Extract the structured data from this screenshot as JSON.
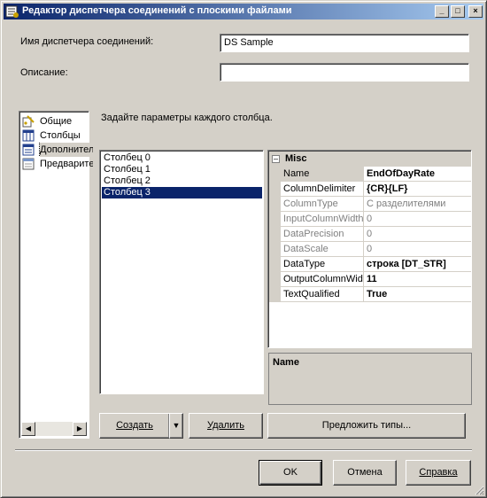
{
  "window": {
    "title": "Редактор диспетчера соединений с плоскими файлами",
    "icon": "flat-file-connection-icon"
  },
  "titlebar_buttons": {
    "minimize": "_",
    "maximize": "□",
    "close": "×"
  },
  "form": {
    "connection_name_label": "Имя диспетчера соединений:",
    "connection_name_value": "DS Sample",
    "description_label": "Описание:",
    "description_value": ""
  },
  "nav": {
    "items": [
      {
        "label": "Общие",
        "icon": "general-icon"
      },
      {
        "label": "Столбцы",
        "icon": "columns-icon"
      },
      {
        "label": "Дополнительно",
        "icon": "advanced-icon",
        "selected": true
      },
      {
        "label": "Предварительный просмотр",
        "icon": "preview-icon"
      }
    ]
  },
  "main": {
    "instruction": "Задайте параметры каждого столбца.",
    "columns": [
      {
        "label": "Столбец 0"
      },
      {
        "label": "Столбец 1"
      },
      {
        "label": "Столбец 2"
      },
      {
        "label": "Столбец 3",
        "selected": true
      }
    ]
  },
  "property_grid": {
    "category": "Misc",
    "rows": [
      {
        "name": "Name",
        "value": "EndOfDayRate",
        "bold": true,
        "readonly": false
      },
      {
        "name": "ColumnDelimiter",
        "value": "{CR}{LF}",
        "bold": true,
        "readonly": false
      },
      {
        "name": "ColumnType",
        "value": "С разделителями",
        "bold": false,
        "readonly": true
      },
      {
        "name": "InputColumnWidth",
        "value": "0",
        "bold": false,
        "readonly": true
      },
      {
        "name": "DataPrecision",
        "value": "0",
        "bold": false,
        "readonly": true
      },
      {
        "name": "DataScale",
        "value": "0",
        "bold": false,
        "readonly": true
      },
      {
        "name": "DataType",
        "value": "строка [DT_STR]",
        "bold": true,
        "readonly": false
      },
      {
        "name": "OutputColumnWidth",
        "value": "11",
        "bold": true,
        "readonly": false
      },
      {
        "name": "TextQualified",
        "value": "True",
        "bold": true,
        "readonly": false
      }
    ],
    "description_title": "Name"
  },
  "buttons": {
    "create": "Создать",
    "create_dropdown": "▼",
    "delete": "Удалить",
    "suggest_types": "Предложить типы...",
    "ok": "OK",
    "cancel": "Отмена",
    "help": "Справка"
  }
}
